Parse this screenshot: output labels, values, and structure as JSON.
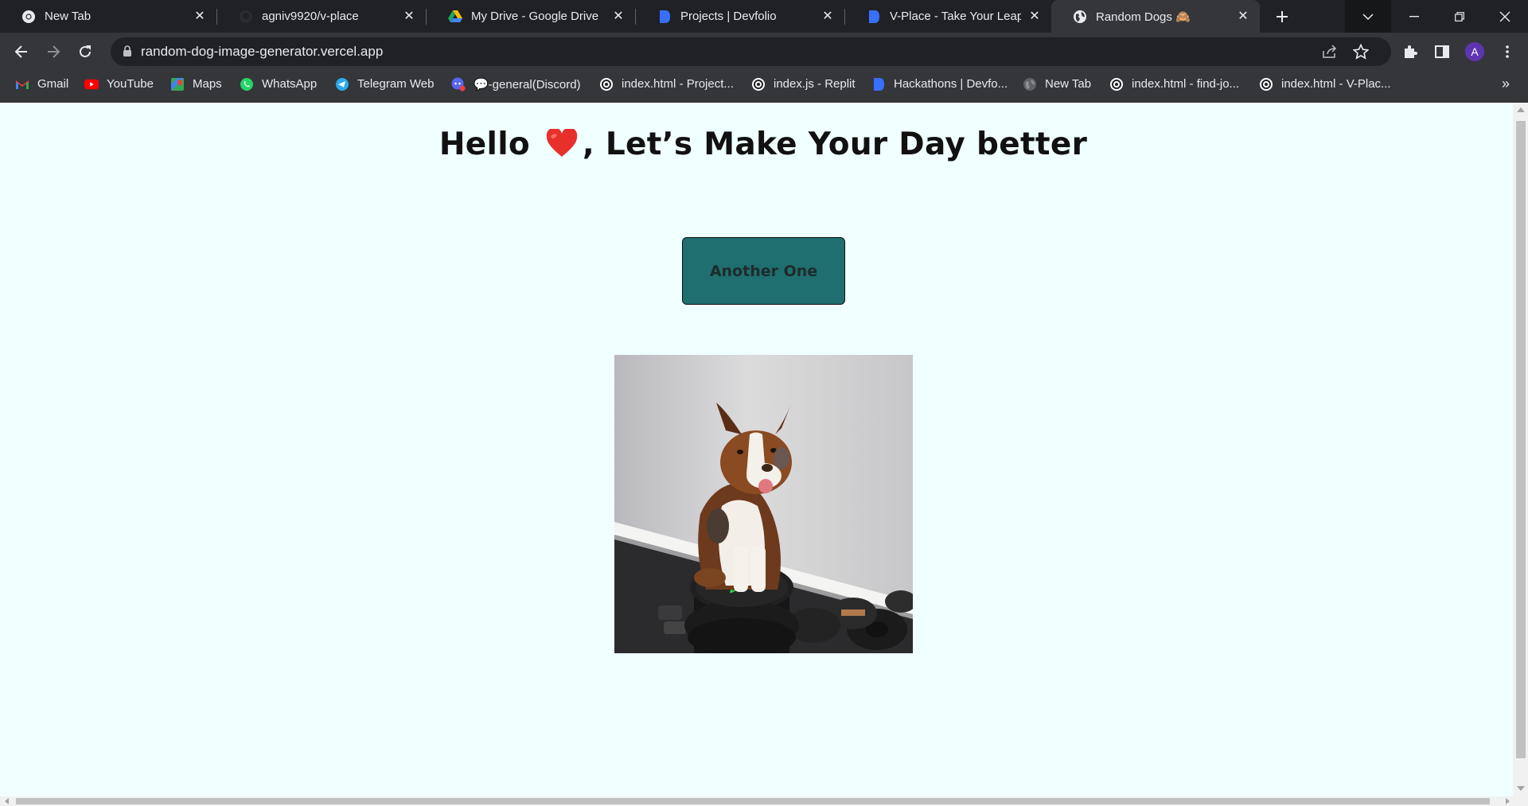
{
  "browser": {
    "tabs": [
      {
        "title": "New Tab",
        "icon": "chrome-icon",
        "active": false
      },
      {
        "title": "agniv9920/v-place",
        "icon": "github-icon",
        "active": false
      },
      {
        "title": "My Drive - Google Drive",
        "icon": "google-drive-icon",
        "active": false
      },
      {
        "title": "Projects | Devfolio",
        "icon": "devfolio-icon",
        "active": false
      },
      {
        "title": "V-Place - Take Your Leap | D",
        "icon": "devfolio-icon",
        "active": false
      },
      {
        "title": "Random Dogs 🙈",
        "icon": "globe-icon",
        "active": true
      }
    ],
    "url": "random-dog-image-generator.vercel.app",
    "profile_initial": "A",
    "bookmarks": [
      {
        "label": "Gmail",
        "icon": "gmail-icon"
      },
      {
        "label": "YouTube",
        "icon": "youtube-icon"
      },
      {
        "label": "Maps",
        "icon": "maps-icon"
      },
      {
        "label": "WhatsApp",
        "icon": "whatsapp-icon"
      },
      {
        "label": "Telegram Web",
        "icon": "telegram-icon"
      },
      {
        "label": "💬-general(Discord)",
        "icon": "discord-icon"
      },
      {
        "label": "index.html - Project...",
        "icon": "replit-icon"
      },
      {
        "label": "index.js - Replit",
        "icon": "replit-icon"
      },
      {
        "label": "Hackathons | Devfo...",
        "icon": "devfolio-icon"
      },
      {
        "label": "New Tab",
        "icon": "globe-icon"
      },
      {
        "label": "index.html - find-jo...",
        "icon": "replit-icon"
      },
      {
        "label": "index.html - V-Plac...",
        "icon": "replit-icon"
      }
    ],
    "bookmarks_overflow": "»"
  },
  "page": {
    "headline_before": "Hello",
    "headline_after": ", Let’s Make Your Day better",
    "button_label": "Another One",
    "image_subject": "dog-photo"
  },
  "colors": {
    "page_background": "#f0ffff",
    "button_background": "#1f6e70",
    "heart": "#e8302b",
    "tab_strip": "#202124",
    "toolbar": "#35363a"
  }
}
